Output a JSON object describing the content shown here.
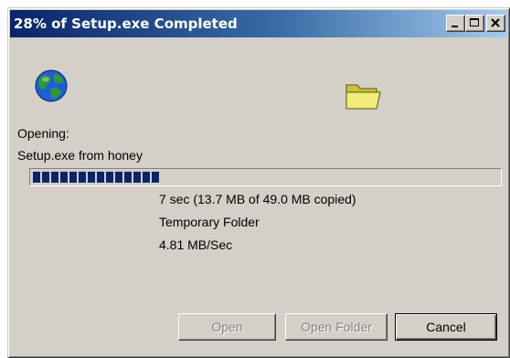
{
  "window": {
    "title": "28% of Setup.exe Completed",
    "caption_buttons": [
      "minimize",
      "maximize",
      "close"
    ]
  },
  "icons": {
    "source": "globe-icon",
    "destination": "folder-icon"
  },
  "status": {
    "action_label": "Opening:",
    "file_line": "Setup.exe from honey"
  },
  "progress": {
    "percent": 28
  },
  "details": {
    "time_line": "7 sec (13.7 MB of 49.0 MB copied)",
    "destination_line": "Temporary Folder",
    "rate_line": "4.81 MB/Sec"
  },
  "buttons": {
    "open_label": "Open",
    "open_folder_label": "Open Folder",
    "cancel_label": "Cancel"
  },
  "colors": {
    "title_start": "#0a246a",
    "title_end": "#a6caf0",
    "face": "#d4d0c8",
    "progress_block": "#0a246a"
  }
}
